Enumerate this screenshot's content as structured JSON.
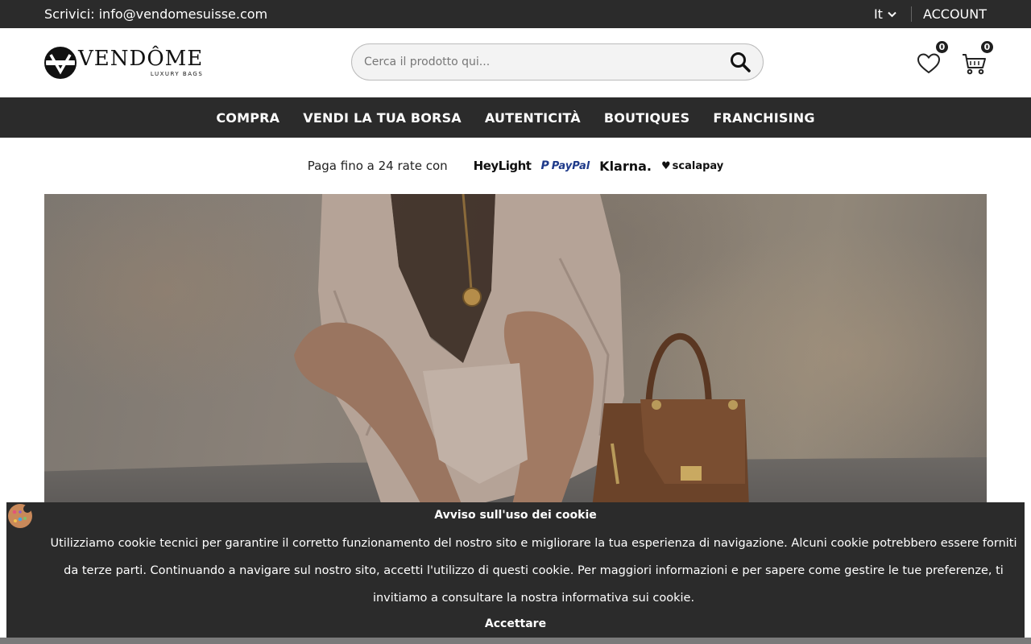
{
  "topbar": {
    "contact": "Scrivici: info@vendomesuisse.com",
    "language": "It",
    "account": "ACCOUNT"
  },
  "header": {
    "logo_word": "VENDÔME",
    "logo_sub": "LUXURY BAGS",
    "search_placeholder": "Cerca il prodotto qui...",
    "wishlist_count": "0",
    "cart_count": "0"
  },
  "nav": {
    "items": [
      {
        "label": "COMPRA"
      },
      {
        "label": "VENDI LA TUA BORSA"
      },
      {
        "label": "AUTENTICITÀ"
      },
      {
        "label": "BOUTIQUES"
      },
      {
        "label": "FRANCHISING"
      }
    ]
  },
  "payment": {
    "text": "Paga fino a 24 rate con",
    "providers": [
      "HeyLight",
      "PayPal",
      "Klarna.",
      "scalapay"
    ]
  },
  "cookie": {
    "title": "Avviso sull'uso dei cookie",
    "body": "Utilizziamo cookie tecnici per garantire il corretto funzionamento del nostro sito e migliorare la tua esperienza di navigazione. Alcuni cookie potrebbero essere forniti da terze parti. Continuando a navigare sul nostro sito, accetti l'utilizzo di questi cookie. Per maggiori informazioni e per sapere come gestire le tue preferenze, ti invitiamo a consultare la nostra informativa sui cookie.",
    "accept": "Accettare"
  },
  "colors": {
    "dark_bar": "#2b2b2b",
    "bag_brown": "#6b4329"
  }
}
